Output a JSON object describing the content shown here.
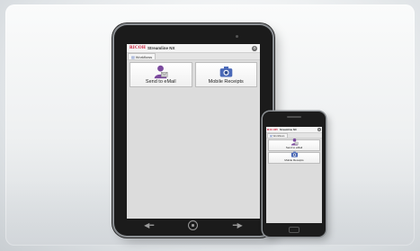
{
  "app": {
    "brand_logo": "RICOH",
    "app_name": "Streamline NX",
    "settings_icon": "gear-icon",
    "workflow_tab": "Workflows"
  },
  "tiles": [
    {
      "label": "Send to eMail",
      "icon": "person-email-icon"
    },
    {
      "label": "Mobile Receipts",
      "icon": "camera-icon"
    }
  ],
  "tablet_nav": {
    "back_icon": "back-arrow-icon",
    "home_icon": "home-icon",
    "menu_icon": "menu-arrow-icon"
  },
  "colors": {
    "brand_red": "#c8102e",
    "accent_blue": "#4a69b8",
    "person_purple": "#7b4a9e",
    "screen_bg": "#dcdcdc"
  }
}
